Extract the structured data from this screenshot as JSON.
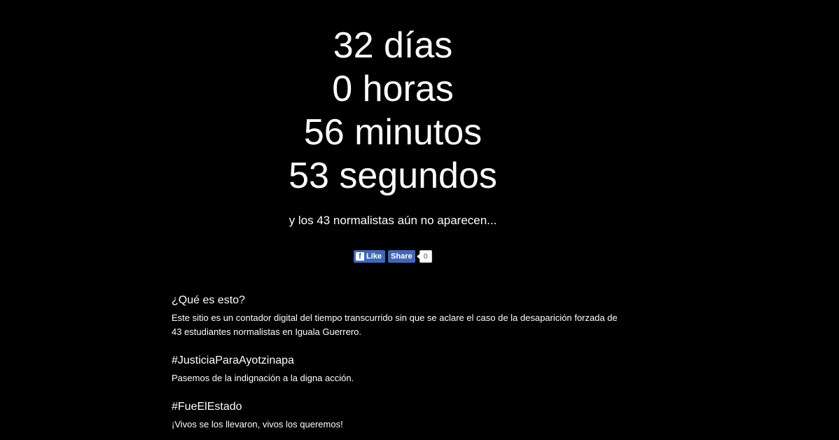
{
  "counter": {
    "days": "32 días",
    "hours": "0 horas",
    "minutes": "56 minutos",
    "seconds": "53 segundos"
  },
  "subtitle": "y los 43 normalistas aún no aparecen...",
  "social": {
    "like_label": "Like",
    "share_label": "Share",
    "share_count": "0",
    "icon": "facebook-icon",
    "brand_color": "#4267b2"
  },
  "sections": [
    {
      "title": "¿Qué es esto?",
      "text": "Este sitio es un contador digital del tiempo transcurrido sin que se aclare el caso de la desaparición forzada de 43 estudiantes normalistas en Iguala Guerrero."
    },
    {
      "title": "#JusticiaParaAyotzinapa",
      "text": "Pasemos de la indignación a la digna acción."
    },
    {
      "title": "#FueElEstado",
      "text": "¡Vivos se los llevaron, vivos los queremos!"
    }
  ]
}
